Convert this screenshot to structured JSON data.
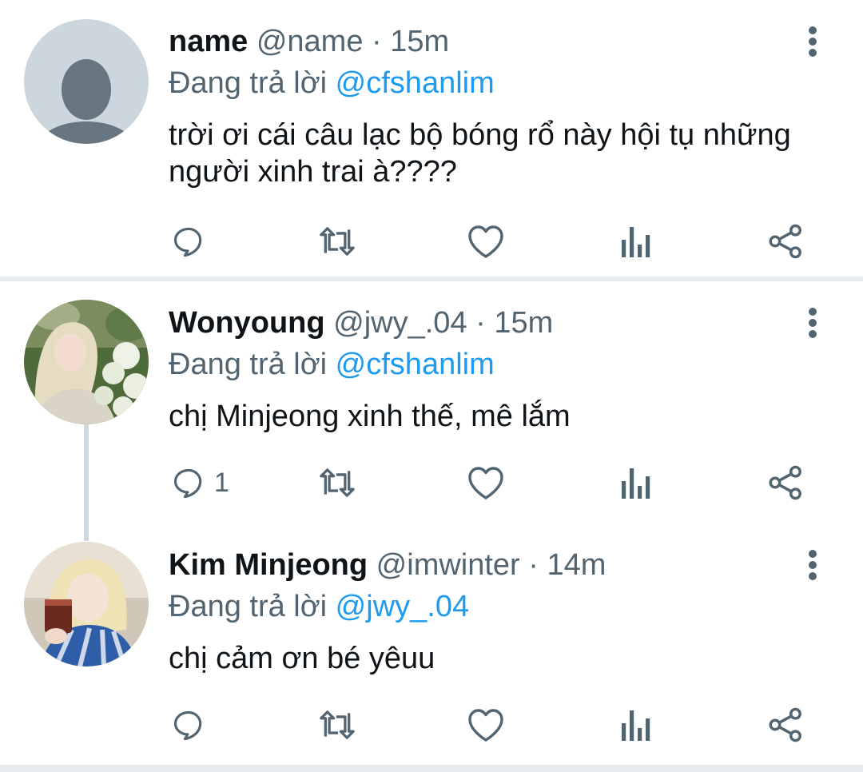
{
  "tweets": [
    {
      "name": "name",
      "handle": "@name",
      "separator": "·",
      "time": "15m",
      "reply_prefix": "Đang trả lời",
      "reply_to": "@cfshanlim",
      "text": "trời ơi cái câu lạc bộ bóng rổ này hội tụ những người xinh trai à????",
      "reply_count": ""
    },
    {
      "name": "Wonyoung",
      "handle": "@jwy_.04",
      "separator": "·",
      "time": "15m",
      "reply_prefix": "Đang trả lời",
      "reply_to": "@cfshanlim",
      "text": "chị Minjeong xinh thế, mê lắm",
      "reply_count": "1"
    },
    {
      "name": "Kim Minjeong",
      "handle": "@imwinter",
      "separator": "·",
      "time": "14m",
      "reply_prefix": "Đang trả lời",
      "reply_to": "@jwy_.04",
      "text": "chị cảm ơn bé yêuu",
      "reply_count": ""
    }
  ],
  "icons": {
    "reply": "reply-icon",
    "retweet": "retweet-icon",
    "like": "heart-icon",
    "stats": "analytics-icon",
    "share": "share-icon",
    "more": "more-vertical-icon"
  },
  "colors": {
    "text": "#0f1419",
    "secondary": "#536471",
    "mention": "#1d9bf0",
    "divider": "#e8ebed",
    "thread_line": "#cfd9de"
  }
}
